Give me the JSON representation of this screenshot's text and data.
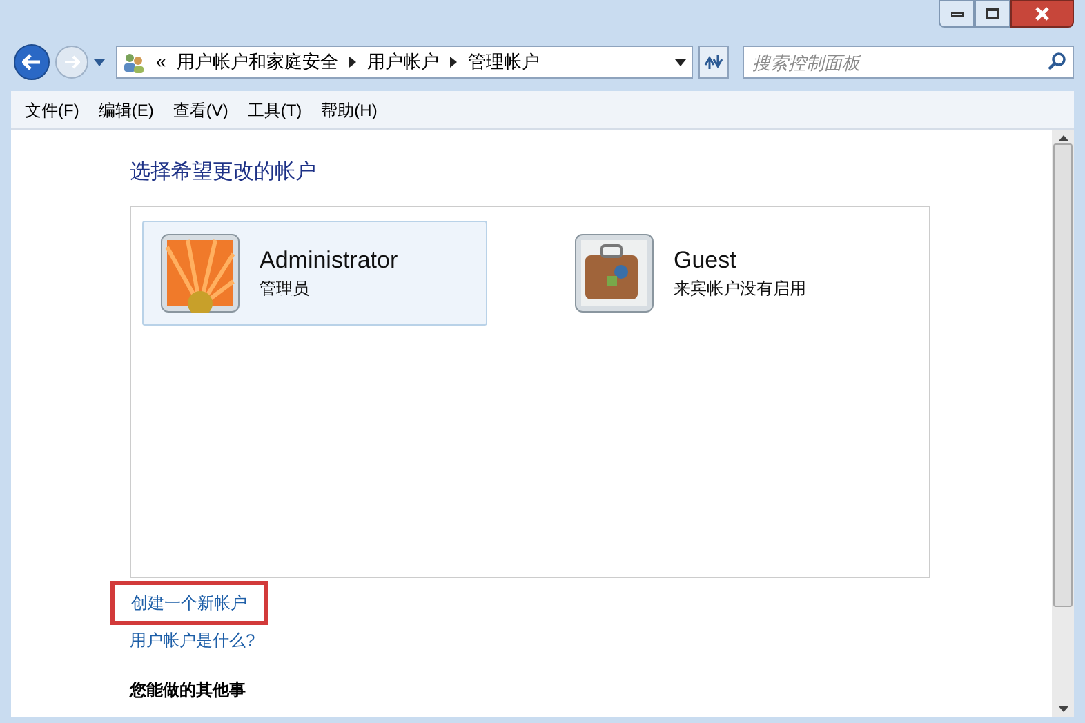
{
  "address_bar": {
    "overflow": "«",
    "breadcrumbs": [
      "用户帐户和家庭安全",
      "用户帐户",
      "管理帐户"
    ]
  },
  "search": {
    "placeholder": "搜索控制面板"
  },
  "menu": [
    "文件(F)",
    "编辑(E)",
    "查看(V)",
    "工具(T)",
    "帮助(H)"
  ],
  "heading": "选择希望更改的帐户",
  "accounts": [
    {
      "name": "Administrator",
      "description": "管理员",
      "kind": "flower",
      "selected": true
    },
    {
      "name": "Guest",
      "description": "来宾帐户没有启用",
      "kind": "suitcase",
      "selected": false
    }
  ],
  "links": [
    {
      "text": "创建一个新帐户",
      "highlighted": true
    },
    {
      "text": "用户帐户是什么?",
      "highlighted": false
    }
  ],
  "section_title": "您能做的其他事"
}
